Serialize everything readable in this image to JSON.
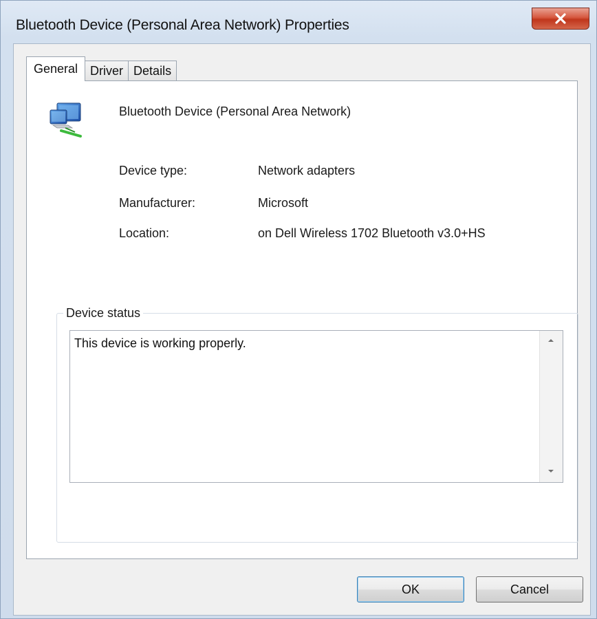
{
  "window": {
    "title": "Bluetooth Device (Personal Area Network) Properties",
    "close_icon": "close-icon"
  },
  "tabs": [
    {
      "label": "General",
      "active": true
    },
    {
      "label": "Driver",
      "active": false
    },
    {
      "label": "Details",
      "active": false
    }
  ],
  "general": {
    "device_icon": "network-adapter-icon",
    "device_name": "Bluetooth Device (Personal Area Network)",
    "properties": [
      {
        "label": "Device type:",
        "value": "Network adapters"
      },
      {
        "label": "Manufacturer:",
        "value": "Microsoft"
      },
      {
        "label": "Location:",
        "value": "on Dell Wireless 1702 Bluetooth v3.0+HS"
      }
    ],
    "status_group_title": "Device status",
    "status_text": "This device is working properly."
  },
  "buttons": {
    "ok": "OK",
    "cancel": "Cancel"
  }
}
